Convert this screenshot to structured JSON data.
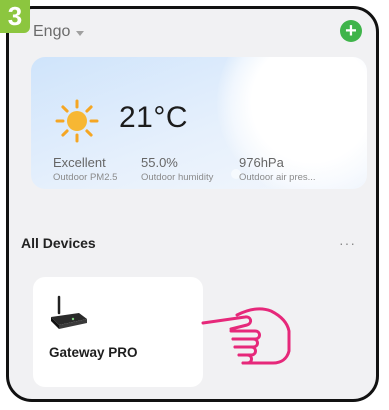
{
  "step": {
    "number": "3"
  },
  "header": {
    "home_name": "Engo",
    "add_button_label": "+"
  },
  "weather": {
    "temperature": "21°C",
    "stats": [
      {
        "value": "Excellent",
        "label": "Outdoor PM2.5"
      },
      {
        "value": "55.0%",
        "label": "Outdoor humidity"
      },
      {
        "value": "976hPa",
        "label": "Outdoor air pres..."
      }
    ]
  },
  "devices": {
    "section_title": "All Devices",
    "more_label": "···",
    "items": [
      {
        "name": "Gateway PRO"
      }
    ]
  },
  "colors": {
    "accent_green": "#3fb44a",
    "badge_green": "#8cc63f",
    "hand_pink": "#e6287a",
    "sun_yellow": "#f5a623"
  },
  "icons": [
    "sun-icon",
    "add-icon",
    "caret-down-icon",
    "more-icon",
    "gateway-router-icon",
    "pointing-hand-icon"
  ]
}
